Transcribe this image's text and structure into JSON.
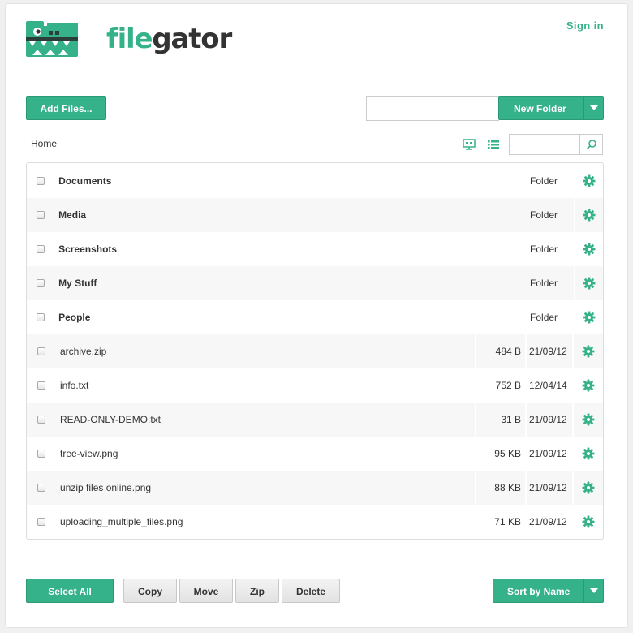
{
  "brand": {
    "logo_part1": "file",
    "logo_part2": "gator",
    "accent_color": "#36b28a"
  },
  "header": {
    "signin_label": "Sign in"
  },
  "toolbar": {
    "add_files_label": "Add Files...",
    "new_folder_label": "New Folder",
    "new_folder_placeholder": ""
  },
  "breadcrumb": {
    "home_label": "Home"
  },
  "view": {
    "tree_icon": "tree-view-icon",
    "list_icon": "list-view-icon",
    "search_placeholder": "",
    "search_icon": "magnifier-icon"
  },
  "files": [
    {
      "name": "Documents",
      "kind": "folder",
      "type_label": "Folder"
    },
    {
      "name": "Media",
      "kind": "folder",
      "type_label": "Folder"
    },
    {
      "name": "Screenshots",
      "kind": "folder",
      "type_label": "Folder"
    },
    {
      "name": "My Stuff",
      "kind": "folder",
      "type_label": "Folder"
    },
    {
      "name": "People",
      "kind": "folder",
      "type_label": "Folder"
    },
    {
      "name": "archive.zip",
      "kind": "file",
      "size": "484 B",
      "date": "21/09/12"
    },
    {
      "name": "info.txt",
      "kind": "file",
      "size": "752 B",
      "date": "12/04/14"
    },
    {
      "name": "READ-ONLY-DEMO.txt",
      "kind": "file",
      "size": "31 B",
      "date": "21/09/12"
    },
    {
      "name": "tree-view.png",
      "kind": "file",
      "size": "95 KB",
      "date": "21/09/12"
    },
    {
      "name": "unzip files online.png",
      "kind": "file",
      "size": "88 KB",
      "date": "21/09/12"
    },
    {
      "name": "uploading_multiple_files.png",
      "kind": "file",
      "size": "71 KB",
      "date": "21/09/12"
    }
  ],
  "footer": {
    "select_all_label": "Select All",
    "copy_label": "Copy",
    "move_label": "Move",
    "zip_label": "Zip",
    "delete_label": "Delete",
    "sort_label": "Sort by Name"
  }
}
